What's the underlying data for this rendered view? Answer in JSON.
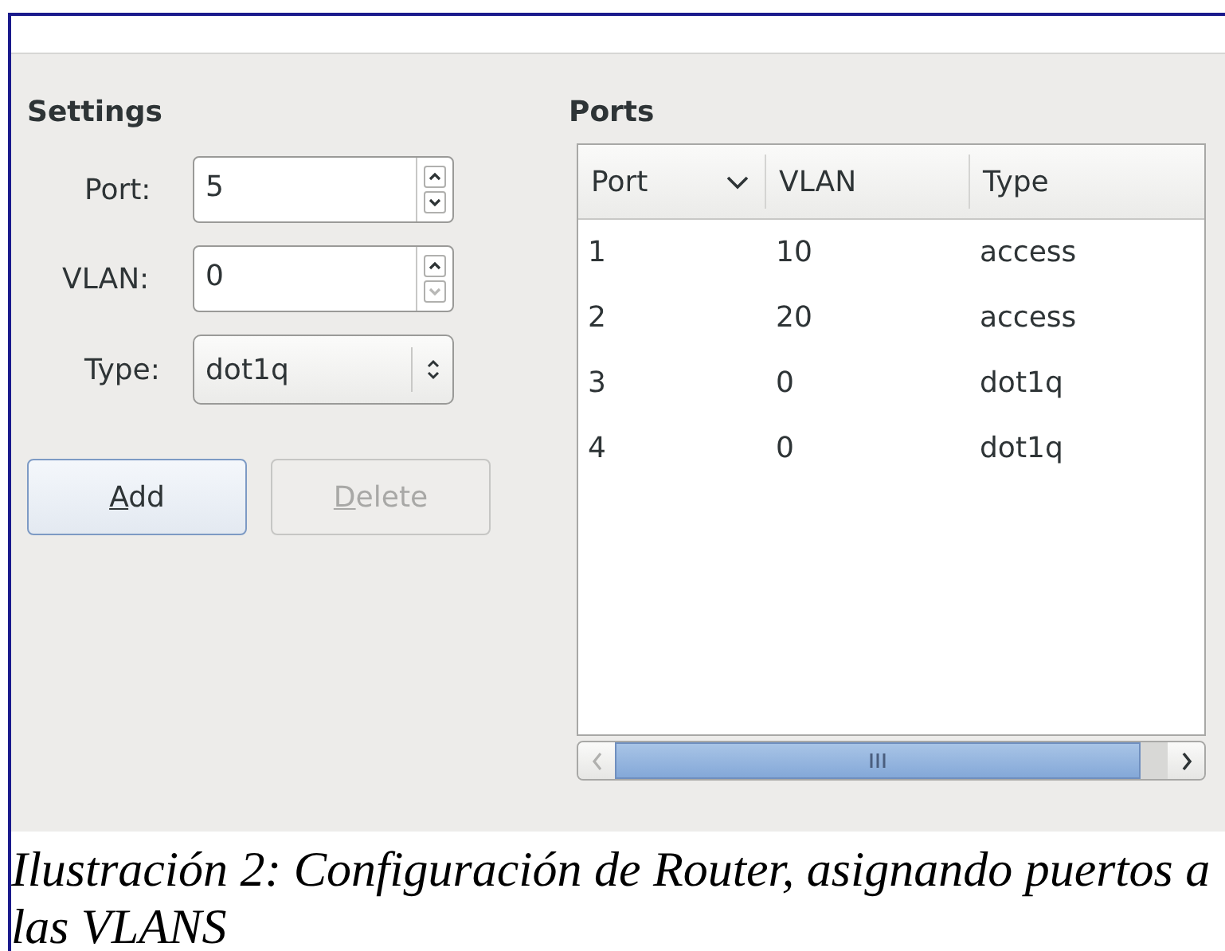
{
  "settings": {
    "title": "Settings",
    "fields": [
      {
        "kind": "spin",
        "label": "Port:",
        "value": "5",
        "up_disabled": false,
        "down_disabled": false
      },
      {
        "kind": "spin",
        "label": "VLAN:",
        "value": "0",
        "up_disabled": false,
        "down_disabled": true
      },
      {
        "kind": "combo",
        "label": "Type:",
        "value": "dot1q"
      }
    ],
    "buttons": [
      {
        "label": "Add",
        "disabled": false,
        "mnemonic_underlined": true
      },
      {
        "label": "Delete",
        "disabled": true,
        "mnemonic_underlined": true
      }
    ]
  },
  "ports": {
    "title": "Ports",
    "columns": [
      {
        "label": "Port",
        "sorted": true
      },
      {
        "label": "VLAN",
        "sorted": false
      },
      {
        "label": "Type",
        "sorted": false
      }
    ],
    "rows": [
      [
        "1",
        "10",
        "access"
      ],
      [
        "2",
        "20",
        "access"
      ],
      [
        "3",
        "0",
        "dot1q"
      ],
      [
        "4",
        "0",
        "dot1q"
      ]
    ]
  },
  "caption": "Ilustración 2: Configuración de Router, asignando puertos a las VLANS"
}
